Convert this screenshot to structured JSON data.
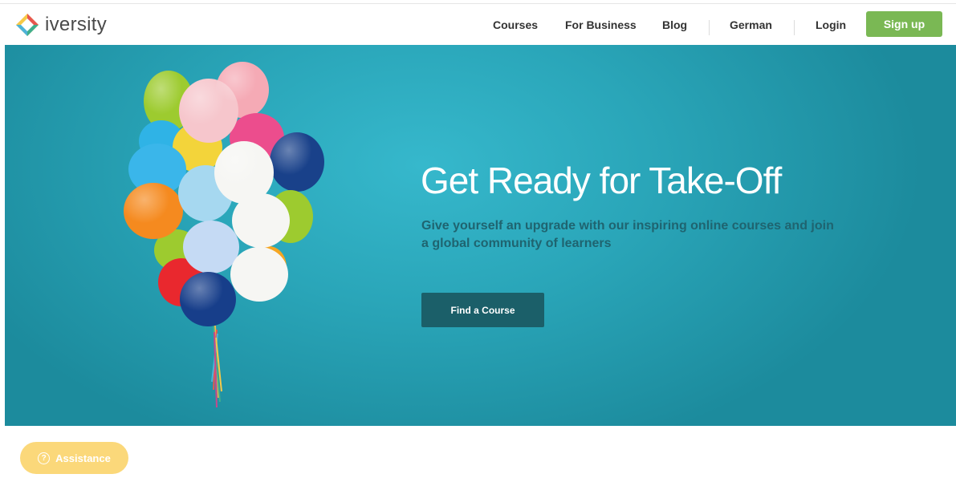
{
  "header": {
    "brand": "iversity",
    "nav": [
      {
        "label": "Courses"
      },
      {
        "label": "For Business"
      },
      {
        "label": "Blog"
      },
      {
        "label": "German"
      },
      {
        "label": "Login"
      }
    ],
    "signup_label": "Sign up"
  },
  "hero": {
    "title": "Get Ready for Take-Off",
    "subtitle": "Give yourself an upgrade with our inspiring online courses and join a global community of learners",
    "cta_label": "Find a Course",
    "image": "balloons"
  },
  "assistance": {
    "label": "Assistance",
    "icon": "question-circle-icon"
  },
  "colors": {
    "hero_bg": "#2aa6b9",
    "signup": "#7ab854",
    "cta": "#1b5f69",
    "assistance": "#fbd87a"
  }
}
